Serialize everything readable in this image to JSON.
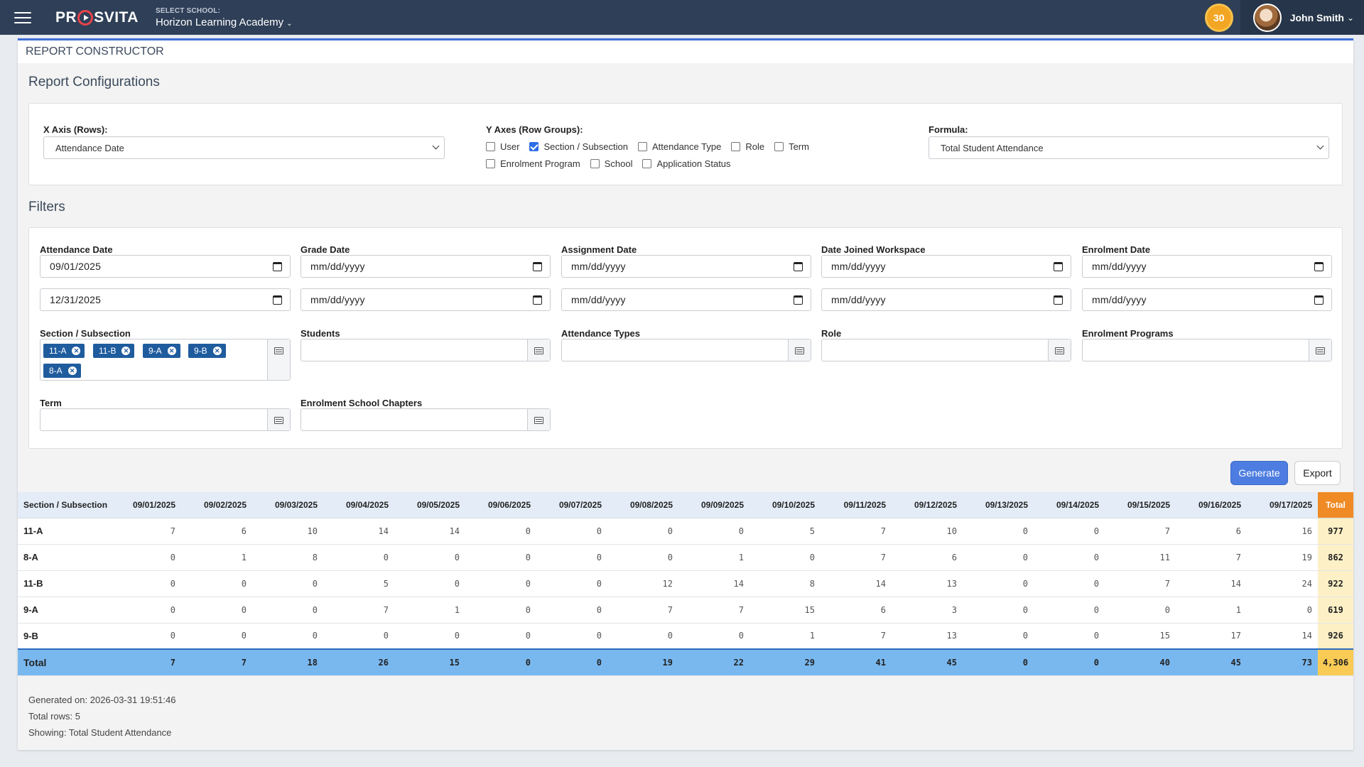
{
  "app": {
    "logo_text": "PROSVITA",
    "school_label": "SELECT SCHOOL:",
    "school_value": "Horizon Learning Academy",
    "points": "30",
    "user_name": "John Smith"
  },
  "page": {
    "title": "REPORT CONSTRUCTOR",
    "config_title": "Report Configurations",
    "filters_title": "Filters"
  },
  "config": {
    "x_axis_label": "X Axis (Rows):",
    "x_axis_value": "Attendance Date",
    "y_axes_label": "Y Axes (Row Groups):",
    "y_axes_options": [
      {
        "label": "User",
        "checked": false
      },
      {
        "label": "Section / Subsection",
        "checked": true
      },
      {
        "label": "Attendance Type",
        "checked": false
      },
      {
        "label": "Role",
        "checked": false
      },
      {
        "label": "Term",
        "checked": false
      },
      {
        "label": "Enrolment Program",
        "checked": false
      },
      {
        "label": "School",
        "checked": false
      },
      {
        "label": "Application Status",
        "checked": false
      }
    ],
    "formula_label": "Formula:",
    "formula_value": "Total Student Attendance"
  },
  "filters": {
    "attendance_date": {
      "label": "Attendance Date",
      "from": "09/01/2025",
      "to": "12/31/2025"
    },
    "grade_date": {
      "label": "Grade Date",
      "from": "mm/dd/yyyy",
      "to": "mm/dd/yyyy"
    },
    "assignment_date": {
      "label": "Assignment Date",
      "from": "mm/dd/yyyy",
      "to": "mm/dd/yyyy"
    },
    "date_joined": {
      "label": "Date Joined Workspace",
      "from": "mm/dd/yyyy",
      "to": "mm/dd/yyyy"
    },
    "enrolment_date": {
      "label": "Enrolment Date",
      "from": "mm/dd/yyyy",
      "to": "mm/dd/yyyy"
    },
    "section": {
      "label": "Section / Subsection",
      "chips": [
        "11-A",
        "11-B",
        "9-A",
        "9-B",
        "8-A"
      ]
    },
    "students": {
      "label": "Students"
    },
    "attendance_types": {
      "label": "Attendance Types"
    },
    "role": {
      "label": "Role"
    },
    "enrolment_programs": {
      "label": "Enrolment Programs"
    },
    "term": {
      "label": "Term"
    },
    "enrolment_chapters": {
      "label": "Enrolment School Chapters"
    }
  },
  "actions": {
    "generate": "Generate",
    "export": "Export"
  },
  "table": {
    "first_header": "Section / Subsection",
    "date_headers": [
      "09/01/2025",
      "09/02/2025",
      "09/03/2025",
      "09/04/2025",
      "09/05/2025",
      "09/06/2025",
      "09/07/2025",
      "09/08/2025",
      "09/09/2025",
      "09/10/2025",
      "09/11/2025",
      "09/12/2025",
      "09/13/2025",
      "09/14/2025",
      "09/15/2025",
      "09/16/2025",
      "09/17/2025"
    ],
    "total_header": "Total",
    "rows": [
      {
        "name": "11-A",
        "values": [
          "7",
          "6",
          "10",
          "14",
          "14",
          "0",
          "0",
          "0",
          "0",
          "5",
          "7",
          "10",
          "0",
          "0",
          "7",
          "6",
          "16"
        ],
        "total": "977"
      },
      {
        "name": "8-A",
        "values": [
          "0",
          "1",
          "8",
          "0",
          "0",
          "0",
          "0",
          "0",
          "1",
          "0",
          "7",
          "6",
          "0",
          "0",
          "11",
          "7",
          "19"
        ],
        "total": "862"
      },
      {
        "name": "11-B",
        "values": [
          "0",
          "0",
          "0",
          "5",
          "0",
          "0",
          "0",
          "12",
          "14",
          "8",
          "14",
          "13",
          "0",
          "0",
          "7",
          "14",
          "24"
        ],
        "total": "922"
      },
      {
        "name": "9-A",
        "values": [
          "0",
          "0",
          "0",
          "7",
          "1",
          "0",
          "0",
          "7",
          "7",
          "15",
          "6",
          "3",
          "0",
          "0",
          "0",
          "1",
          "0"
        ],
        "total": "619"
      },
      {
        "name": "9-B",
        "values": [
          "0",
          "0",
          "0",
          "0",
          "0",
          "0",
          "0",
          "0",
          "0",
          "1",
          "7",
          "13",
          "0",
          "0",
          "15",
          "17",
          "14"
        ],
        "total": "926"
      }
    ],
    "total_row": {
      "name": "Total",
      "values": [
        "7",
        "7",
        "18",
        "26",
        "15",
        "0",
        "0",
        "19",
        "22",
        "29",
        "41",
        "45",
        "0",
        "0",
        "40",
        "45",
        "73"
      ],
      "total": "4,306"
    }
  },
  "footer": {
    "generated": "Generated on: 2026-03-31 19:51:46",
    "total_rows": "Total rows: 5",
    "showing": "Showing: Total Student Attendance"
  }
}
